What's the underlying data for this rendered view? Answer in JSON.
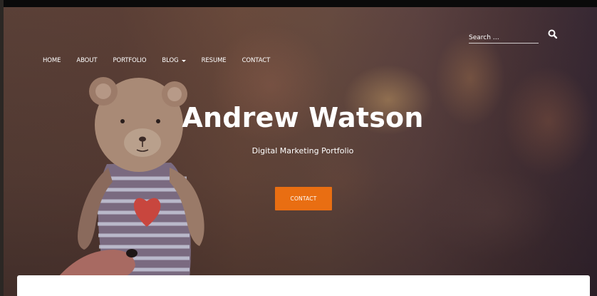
{
  "nav": {
    "items": [
      {
        "label": "HOME"
      },
      {
        "label": "ABOUT"
      },
      {
        "label": "PORTFOLIO"
      },
      {
        "label": "BLOG",
        "has_dropdown": true
      },
      {
        "label": "RESUME"
      },
      {
        "label": "CONTACT"
      }
    ]
  },
  "search": {
    "placeholder": "Search …",
    "icon": "search-icon"
  },
  "hero": {
    "title": "Andrew Watson",
    "subtitle": "Digital Marketing Portfolio",
    "cta_label": "CONTACT"
  },
  "colors": {
    "accent": "#e96e12",
    "text_on_hero": "#ffffff",
    "panel": "#ffffff"
  }
}
